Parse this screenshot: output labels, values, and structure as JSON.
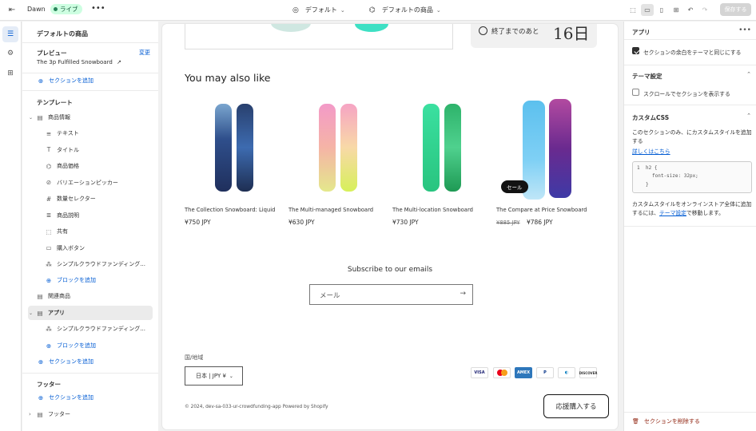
{
  "topbar": {
    "theme_name": "Dawn",
    "live_badge": "ライブ",
    "more": "•••",
    "template_select": "デフォルト",
    "page_select": "デフォルトの商品",
    "save_label": "保存する"
  },
  "left_panel": {
    "title": "デフォルトの商品",
    "preview_label": "プレビュー",
    "preview_change": "変更",
    "preview_value": "The 3p Fulfilled Snowboard",
    "add_section_top": "セクションを追加",
    "template_heading": "テンプレート",
    "product_info": "商品情報",
    "blocks": [
      {
        "label": "テキスト",
        "icon": "text-icon"
      },
      {
        "label": "タイトル",
        "icon": "title-icon"
      },
      {
        "label": "商品価格",
        "icon": "price-tag-icon"
      },
      {
        "label": "バリエーションピッカー",
        "icon": "variant-icon"
      },
      {
        "label": "数量セレクター",
        "icon": "hash-icon"
      },
      {
        "label": "商品説明",
        "icon": "description-icon"
      },
      {
        "label": "共有",
        "icon": "share-icon"
      },
      {
        "label": "購入ボタン",
        "icon": "buy-button-icon"
      },
      {
        "label": "シンプルクラウドファンディング...",
        "icon": "app-block-icon"
      }
    ],
    "add_block": "ブロックを追加",
    "related": "関連商品",
    "apps": "アプリ",
    "apps_block": "シンプルクラウドファンディング...",
    "add_block_2": "ブロックを追加",
    "add_section_2": "セクションを追加",
    "footer_heading": "フッター",
    "add_section_3": "セクションを追加",
    "footer_item": "フッター"
  },
  "canvas": {
    "countdown_label": "終了までのあと",
    "countdown_value": "16日",
    "ymal_title": "You may also like",
    "products": [
      {
        "name": "The Collection Snowboard: Liquid",
        "price": "¥750 JPY"
      },
      {
        "name": "The Multi-managed Snowboard",
        "price": "¥630 JPY"
      },
      {
        "name": "The Multi-location Snowboard",
        "price": "¥730 JPY"
      },
      {
        "name": "The Compare at Price Snowboard",
        "old_price": "¥885 JPY",
        "price": "¥786 JPY",
        "badge": "セール"
      }
    ],
    "subscribe_title": "Subscribe to our emails",
    "email_placeholder": "メール",
    "country_label": "国/地域",
    "country_value": "日本 | JPY ¥",
    "payments": [
      "VISA",
      "MC",
      "AMEX",
      "PayPal",
      "Diners",
      "DISCOVER"
    ],
    "copyright": "© 2024, dev-sa-033-ur-crowdfunding-app Powered by Shopify",
    "support_button": "応援購入する"
  },
  "right_panel": {
    "app_heading": "アプリ",
    "match_theme": "セクションの余白をテーマと同じにする",
    "theme_settings": "テーマ設定",
    "scroll_reveal": "スクロールでセクションを表示する",
    "custom_css": "カスタムCSS",
    "css_desc": "このセクションのみ、にカスタムスタイルを追加する",
    "learn_more": "詳しくはこちら",
    "code_line1": "h2 {",
    "code_line2": "font-size: 32px;",
    "code_line3": "}",
    "css_note_a": "カスタムスタイルをオンラインストア全体に追加するには、",
    "css_note_link": "テーマ設定",
    "css_note_b": "で移動します。",
    "delete_label": "セクションを削除する"
  },
  "colors": {
    "accent": "#005bd3",
    "live_bg": "#cdfee1",
    "danger": "#8e1f0b"
  }
}
